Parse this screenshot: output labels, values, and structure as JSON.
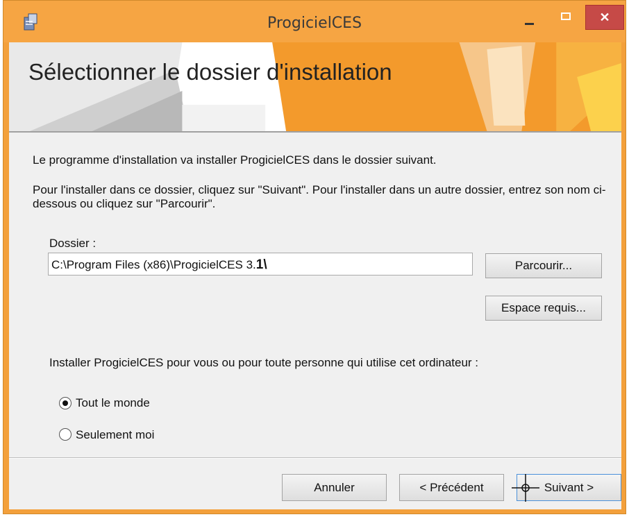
{
  "window": {
    "title": "ProgicielCES",
    "minimize_icon": "minimize-icon",
    "maximize_icon": "maximize-icon",
    "close_label": "✕"
  },
  "banner": {
    "title": "Sélectionner le dossier d'installation"
  },
  "body": {
    "intro": "Le programme d'installation va installer ProgicielCES dans le dossier suivant.",
    "instructions": "Pour l'installer dans ce dossier, cliquez sur \"Suivant\". Pour l'installer dans un autre dossier, entrez son nom ci-dessous ou cliquez sur \"Parcourir\".",
    "folder_label": "Dossier :",
    "folder_value_prefix": "C:\\Program Files (x86)\\ProgicielCES 3.",
    "folder_value_suffix": "1\\",
    "browse_label": "Parcourir...",
    "space_label": "Espace requis...",
    "install_for_label": "Installer ProgicielCES pour vous ou pour toute personne qui utilise cet ordinateur :",
    "options": [
      {
        "label": "Tout le monde",
        "selected": true
      },
      {
        "label": "Seulement moi",
        "selected": false
      }
    ]
  },
  "footer": {
    "cancel_label": "Annuler",
    "prev_label": "< Précédent",
    "next_label": "Suivant >"
  },
  "colors": {
    "title_bar": "#f6a543",
    "close_button": "#c64a47",
    "banner_accent": "#f39a2c"
  }
}
